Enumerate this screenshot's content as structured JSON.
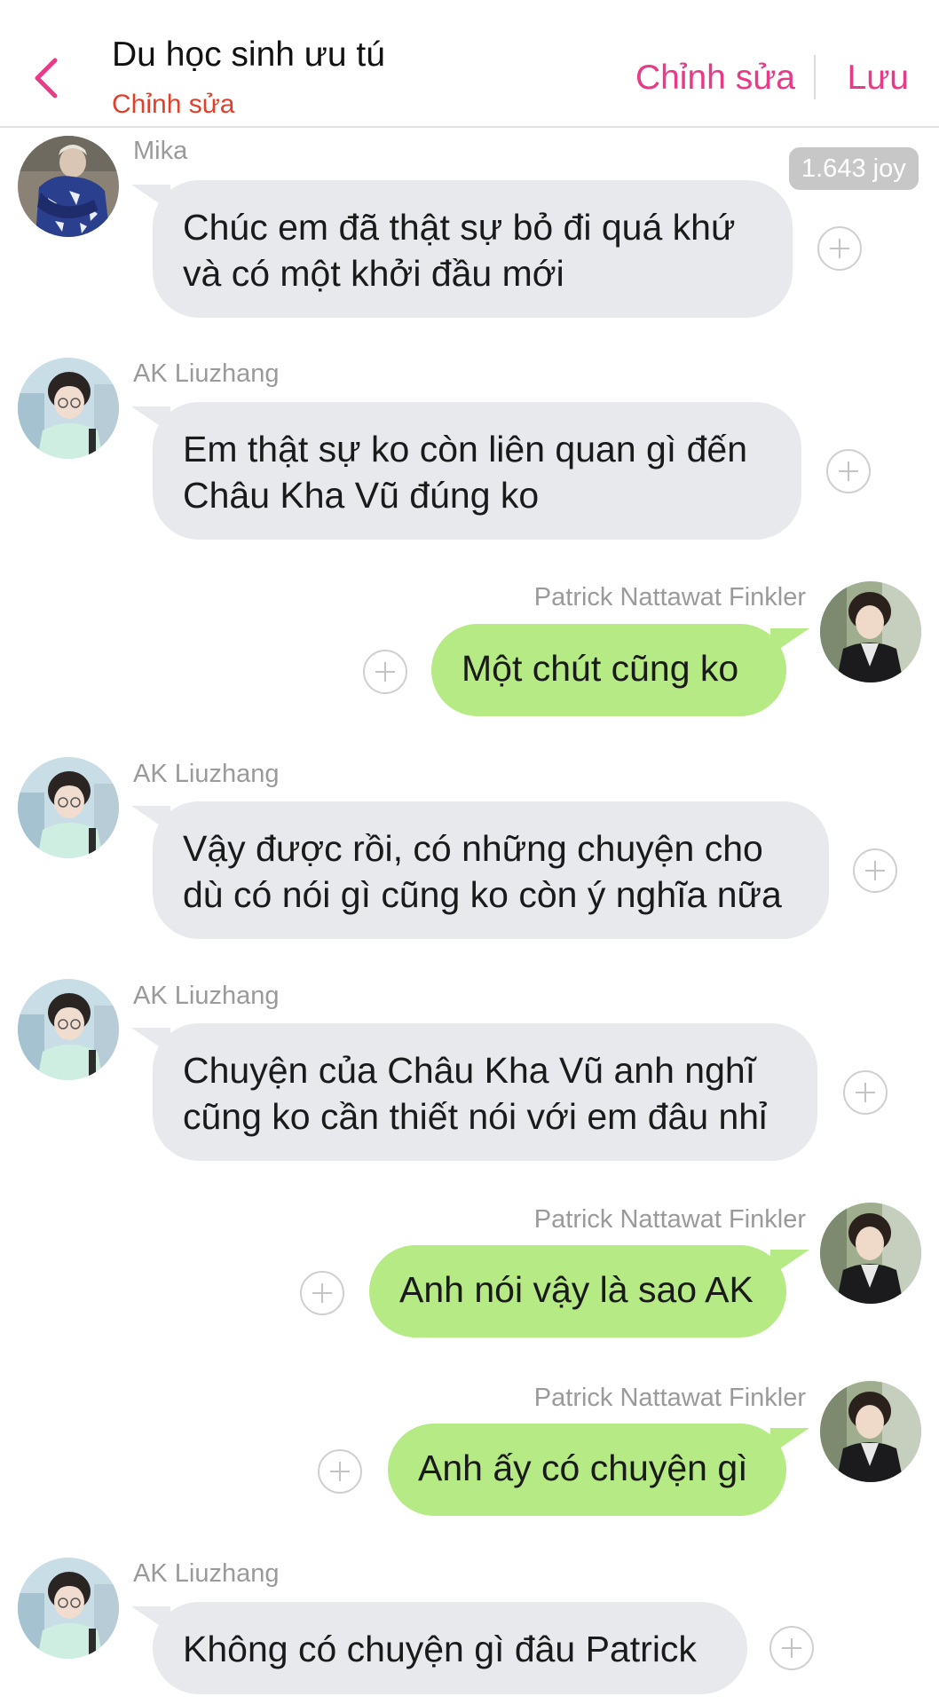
{
  "header": {
    "title": "Du học sinh ưu tú",
    "subtitle": "Chỉnh sửa",
    "edit_label": "Chỉnh sửa",
    "save_label": "Lưu",
    "accent_color": "#e93a87"
  },
  "badge": {
    "joy": "1.643 joy"
  },
  "messages": [
    {
      "sender": "Mika",
      "direction": "incoming",
      "lines": [
        "Chúc em đã thật sự bỏ đi quá khứ",
        "và có một khởi đầu mới"
      ]
    },
    {
      "sender": "AK Liuzhang",
      "direction": "incoming",
      "lines": [
        "Em thật sự ko còn liên quan gì đến",
        "Châu Kha Vũ đúng ko"
      ]
    },
    {
      "sender": "Patrick Nattawat Finkler",
      "direction": "outgoing",
      "lines": [
        "Một chút cũng ko"
      ]
    },
    {
      "sender": "AK Liuzhang",
      "direction": "incoming",
      "lines": [
        "Vậy được rồi, có những chuyện cho",
        "dù có nói gì cũng ko còn ý nghĩa nữa"
      ]
    },
    {
      "sender": "AK Liuzhang",
      "direction": "incoming",
      "lines": [
        "Chuyện của Châu Kha Vũ anh nghĩ",
        "cũng ko cần thiết nói với em đâu nhỉ"
      ]
    },
    {
      "sender": "Patrick Nattawat Finkler",
      "direction": "outgoing",
      "lines": [
        "Anh nói vậy là sao AK"
      ]
    },
    {
      "sender": "Patrick Nattawat Finkler",
      "direction": "outgoing",
      "lines": [
        "Anh ấy có chuyện gì"
      ]
    },
    {
      "sender": "AK Liuzhang",
      "direction": "incoming",
      "lines": [
        "Không có chuyện gì đâu Patrick"
      ]
    }
  ],
  "colors": {
    "incoming_bubble": "#e7e9ed",
    "outgoing_bubble": "#b6ea84",
    "subtitle": "#e0402a"
  }
}
